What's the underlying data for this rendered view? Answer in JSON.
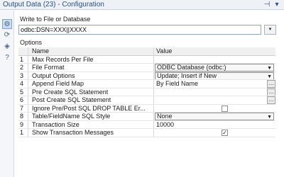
{
  "window": {
    "title": "Output Data (23) - Configuration"
  },
  "rail": {
    "items": [
      "gear-icon",
      "refresh-icon",
      "tag-icon",
      "help-icon"
    ]
  },
  "write_section": {
    "label": "Write to File or Database",
    "connection_value": "odbc:DSN=XXX||XXXX",
    "dropdown_glyph": "▾"
  },
  "options": {
    "label": "Options",
    "columns": [
      "Name",
      "Value"
    ],
    "rows": [
      {
        "num": "1",
        "name": "Max Records Per File",
        "value": ""
      },
      {
        "num": "2",
        "name": "File Format",
        "value": "ODBC Database (odbc:)"
      },
      {
        "num": "3",
        "name": "Output Options",
        "value": "Update; Insert if New"
      },
      {
        "num": "4",
        "name": "Append Field Map",
        "value": "By Field Name"
      },
      {
        "num": "5",
        "name": "Pre Create SQL Statement",
        "value": ""
      },
      {
        "num": "6",
        "name": "Post Create SQL Statement",
        "value": ""
      },
      {
        "num": "7",
        "name": "Ignore Pre/Post SQL DROP TABLE Er...",
        "value": ""
      },
      {
        "num": "8",
        "name": "Table/FieldName SQL Style",
        "value": "None"
      },
      {
        "num": "9",
        "name": "Transaction Size",
        "value": "10000"
      },
      {
        "num": "1",
        "name": "Show Transaction Messages",
        "value": ""
      }
    ],
    "checks": {
      "ignore_drop": false,
      "show_messages": true
    }
  }
}
